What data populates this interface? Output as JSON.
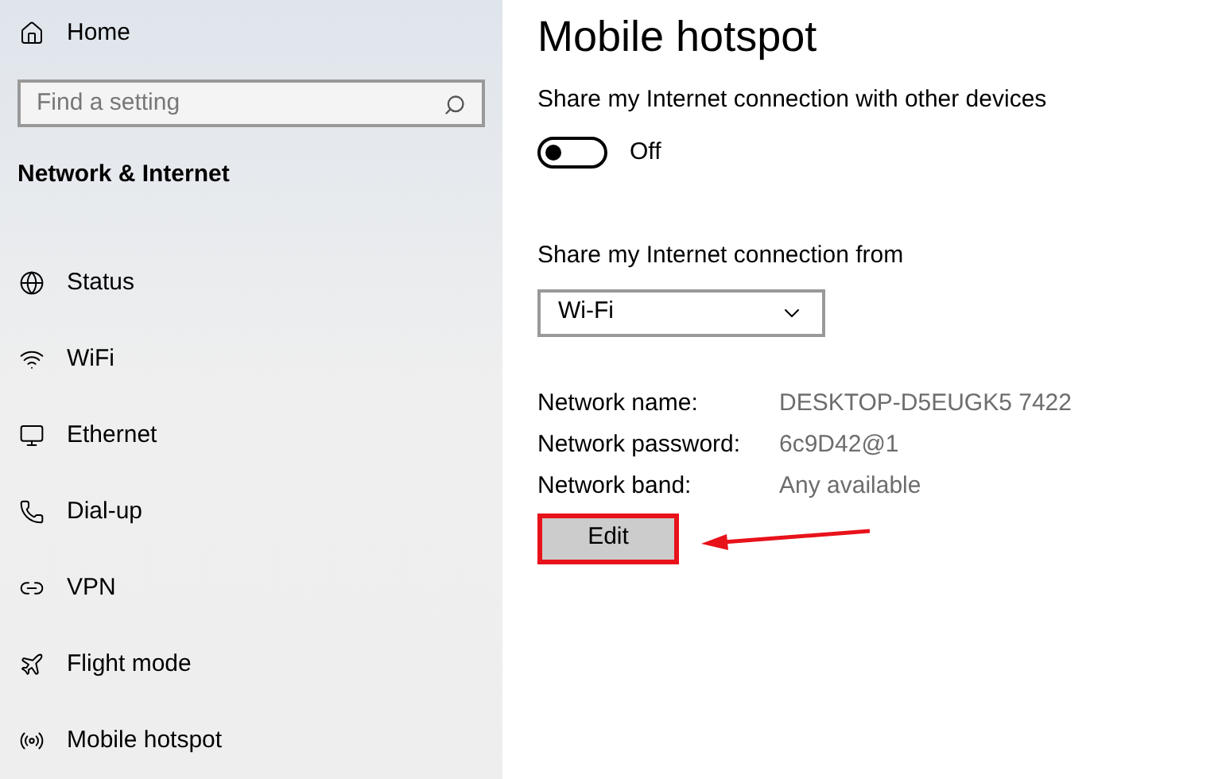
{
  "sidebar": {
    "home": "Home",
    "search": {
      "placeholder": "Find a setting"
    },
    "section_title": "Network & Internet",
    "items": [
      {
        "label": "Status"
      },
      {
        "label": "WiFi"
      },
      {
        "label": "Ethernet"
      },
      {
        "label": "Dial-up"
      },
      {
        "label": "VPN"
      },
      {
        "label": "Flight mode"
      },
      {
        "label": "Mobile hotspot"
      }
    ]
  },
  "main": {
    "title": "Mobile hotspot",
    "share_label": "Share my Internet connection with other devices",
    "toggle": {
      "on": false,
      "label": "Off"
    },
    "from_label": "Share my Internet connection from",
    "dropdown": {
      "value": "Wi-Fi"
    },
    "properties": [
      {
        "label": "Network name:",
        "value": "DESKTOP-D5EUGK5 7422"
      },
      {
        "label": "Network password:",
        "value": "6c9D42@1"
      },
      {
        "label": "Network band:",
        "value": "Any available"
      }
    ],
    "edit_button": {
      "label": "Edit",
      "highlighted": true
    }
  }
}
